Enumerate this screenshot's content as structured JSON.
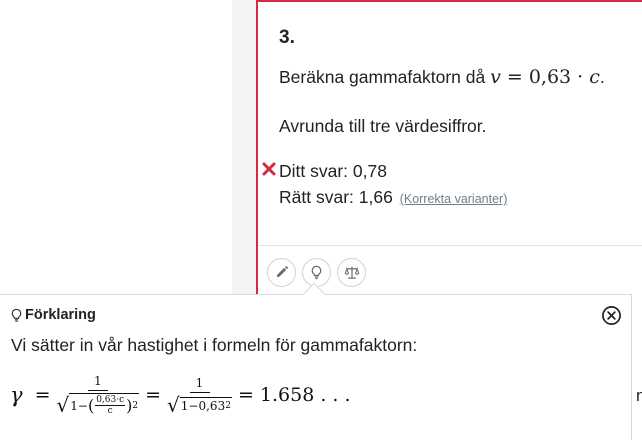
{
  "question": {
    "number": "3.",
    "prompt_text": "Beräkna gammafaktorn då ",
    "prompt_math_var": "v",
    "prompt_math_expr": " = 0,63 · ",
    "prompt_math_c": "c",
    "prompt_end": ".",
    "rounding": "Avrunda till tre värdesiffror.",
    "your_answer": "Ditt svar: 0,78",
    "correct_answer": "Rätt svar: 1,66",
    "variants_link": "(Korrekta varianter)"
  },
  "toolbar": {
    "edit_icon": "pencil-icon",
    "hint_icon": "lightbulb-icon",
    "compare_icon": "scales-icon"
  },
  "explanation": {
    "title": "Förklaring",
    "text": "Vi sätter in vår hastighet i formeln för gammafaktorn:",
    "formula": {
      "gamma": "γ",
      "eq": "=",
      "one": "1",
      "one_minus": "1−",
      "lparen": "(",
      "rparen": ")",
      "inner_num": "0,63·c",
      "inner_den": "c",
      "squared": "2",
      "second_den": "1−0,63",
      "result": "= 1.658 . . ."
    },
    "cut_off_glyph": "n"
  },
  "colors": {
    "accent_red": "#d32a3f",
    "wrong_mark": "#d32a3f",
    "link_gray": "#6c7f8f",
    "gutter": "#f3f3f5"
  }
}
